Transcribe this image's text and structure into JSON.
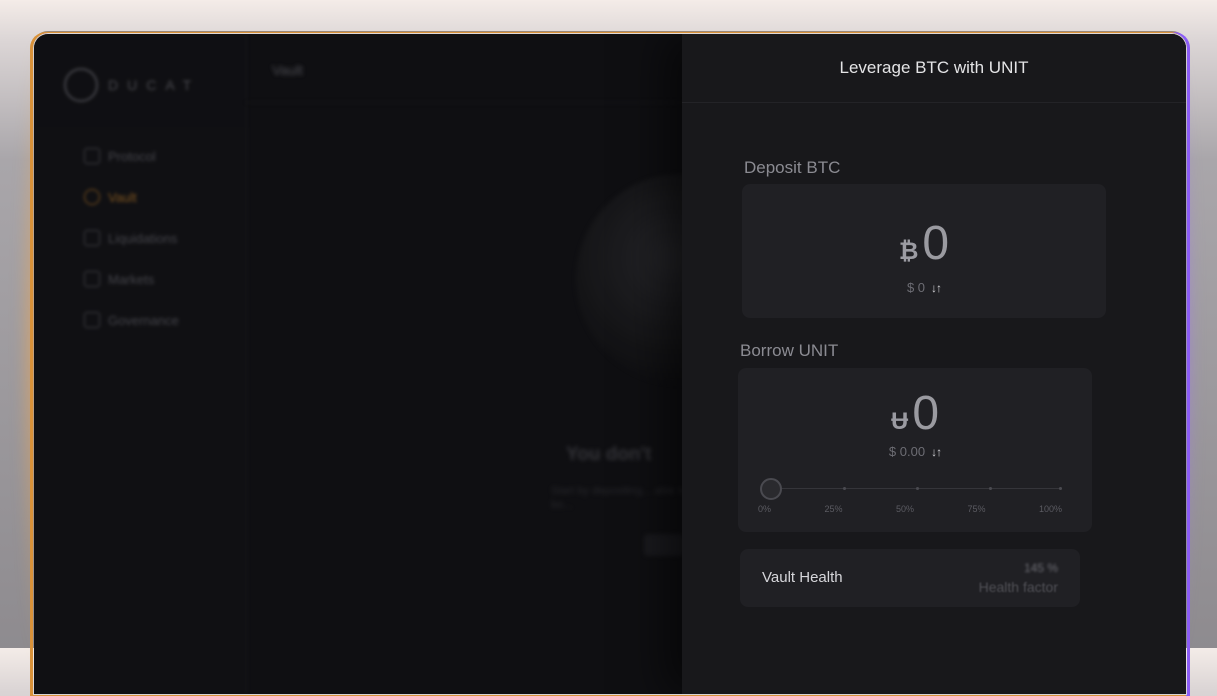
{
  "app": {
    "logo_text": "DUCAT"
  },
  "sidebar": {
    "items": [
      {
        "label": "Protocol",
        "icon": "grid-icon"
      },
      {
        "label": "Vault",
        "icon": "vault-icon",
        "active": true
      },
      {
        "label": "Liquidations",
        "icon": "document-icon"
      },
      {
        "label": "Markets",
        "icon": "chart-icon"
      },
      {
        "label": "Governance",
        "icon": "bank-icon"
      }
    ]
  },
  "main": {
    "title": "Vault",
    "empty_title": "You don't",
    "empty_subtitle": "Start by depositing... able to bo..."
  },
  "panel": {
    "title": "Leverage BTC with UNIT",
    "deposit": {
      "label": "Deposit BTC",
      "symbol": "₿",
      "amount": "0",
      "usd_value": "$ 0"
    },
    "borrow": {
      "label": "Borrow UNIT",
      "symbol": "Ʉ",
      "amount": "0",
      "usd_value": "$ 0.00",
      "slider_value": 0,
      "ticks": [
        "0%",
        "25%",
        "50%",
        "75%",
        "100%"
      ]
    },
    "health": {
      "label": "Vault Health",
      "value": "145 %",
      "sublabel": "Health factor"
    }
  },
  "colors": {
    "accent_active": "#a06a24",
    "border_left": "#d9923a",
    "border_right": "#8b5cf6",
    "panel_bg": "#18181b"
  }
}
